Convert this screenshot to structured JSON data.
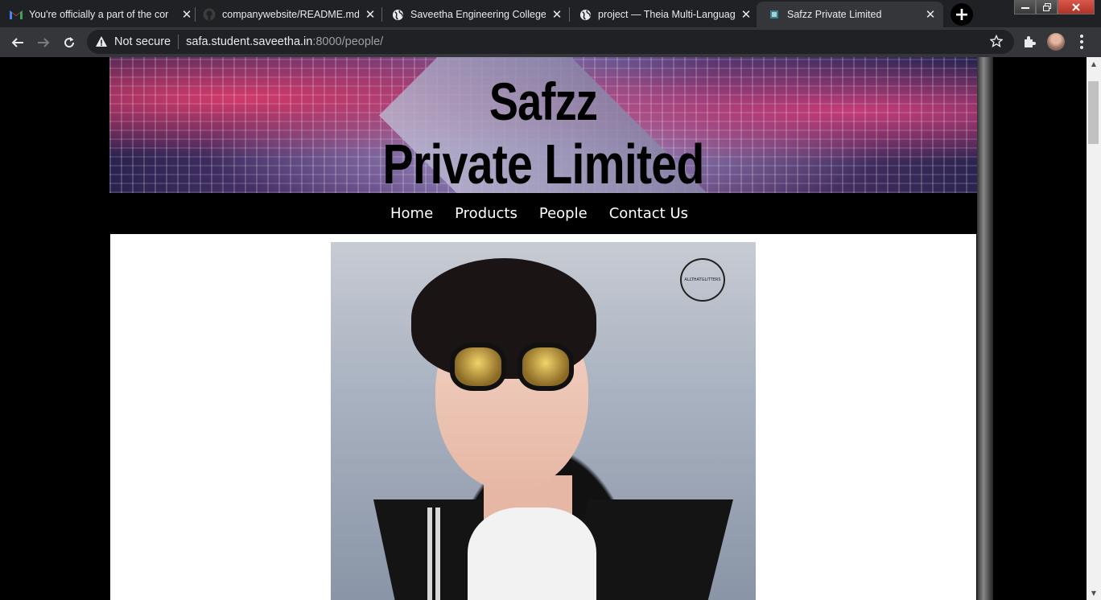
{
  "browser": {
    "tabs": [
      {
        "title": "You're officially a part of the cor",
        "icon": "gmail-icon"
      },
      {
        "title": "companywebsite/README.md a",
        "icon": "github-icon"
      },
      {
        "title": "Saveetha Engineering College",
        "icon": "globe-icon"
      },
      {
        "title": "project — Theia Multi-Language",
        "icon": "globe-icon"
      },
      {
        "title": "Safzz Private Limited",
        "icon": "site-favicon",
        "active": true
      }
    ],
    "close_glyph": "✕",
    "new_tab_glyph": "+",
    "address": {
      "security_label": "Not secure",
      "host": "safa.student.saveetha.in",
      "path": ":8000/people/"
    }
  },
  "site": {
    "brand_line1": "Safzz",
    "brand_line2": "Private Limited",
    "nav": [
      {
        "label": "Home"
      },
      {
        "label": "Products"
      },
      {
        "label": "People"
      },
      {
        "label": "Contact Us"
      }
    ],
    "photo_watermark": "ALLTHATGLITTERS"
  },
  "colors": {
    "chrome_dark": "#202124",
    "chrome_toolbar": "#35363a",
    "page_bg": "#000000",
    "content_bg": "#ffffff",
    "nav_text": "#ffffff"
  }
}
